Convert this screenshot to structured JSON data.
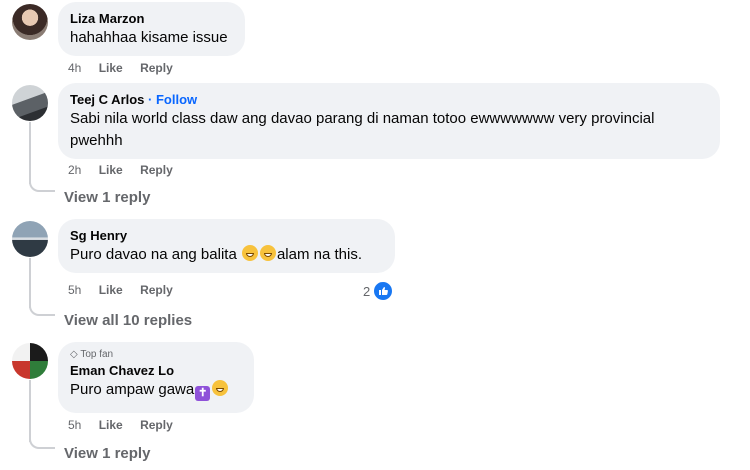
{
  "comments": [
    {
      "author": "Liza Marzon",
      "text": "hahahhaa kisame issue",
      "time": "4h",
      "like": "Like",
      "reply": "Reply"
    },
    {
      "author": "Teej C Arlos",
      "follow": "· Follow",
      "text": "Sabi nila world class daw ang davao parang di naman totoo ewwwwwww very provincial pwehhh",
      "time": "2h",
      "like": "Like",
      "reply": "Reply",
      "view_replies": "View 1 reply"
    },
    {
      "author": "Sg Henry",
      "text": "Puro davao na ang balita",
      "text_after": "alam na this.",
      "time": "5h",
      "like": "Like",
      "reply": "Reply",
      "reaction_count": "2",
      "view_replies": "View all 10 replies"
    },
    {
      "badge": "Top fan",
      "author": "Eman Chavez Lo",
      "text": "Puro ampaw gawa",
      "time": "5h",
      "like": "Like",
      "reply": "Reply",
      "view_replies": "View 1 reply"
    }
  ],
  "icons": {
    "emoji_1": "grinning-face",
    "emoji_2": "latin-cross",
    "emoji_3": "grimacing-face",
    "reaction": "thumbs-up",
    "badge": "diamond-icon"
  },
  "colors": {
    "bubble": "#f0f2f5",
    "link": "#0866ff",
    "meta": "#65676b",
    "like_badge": "#1877f2"
  }
}
